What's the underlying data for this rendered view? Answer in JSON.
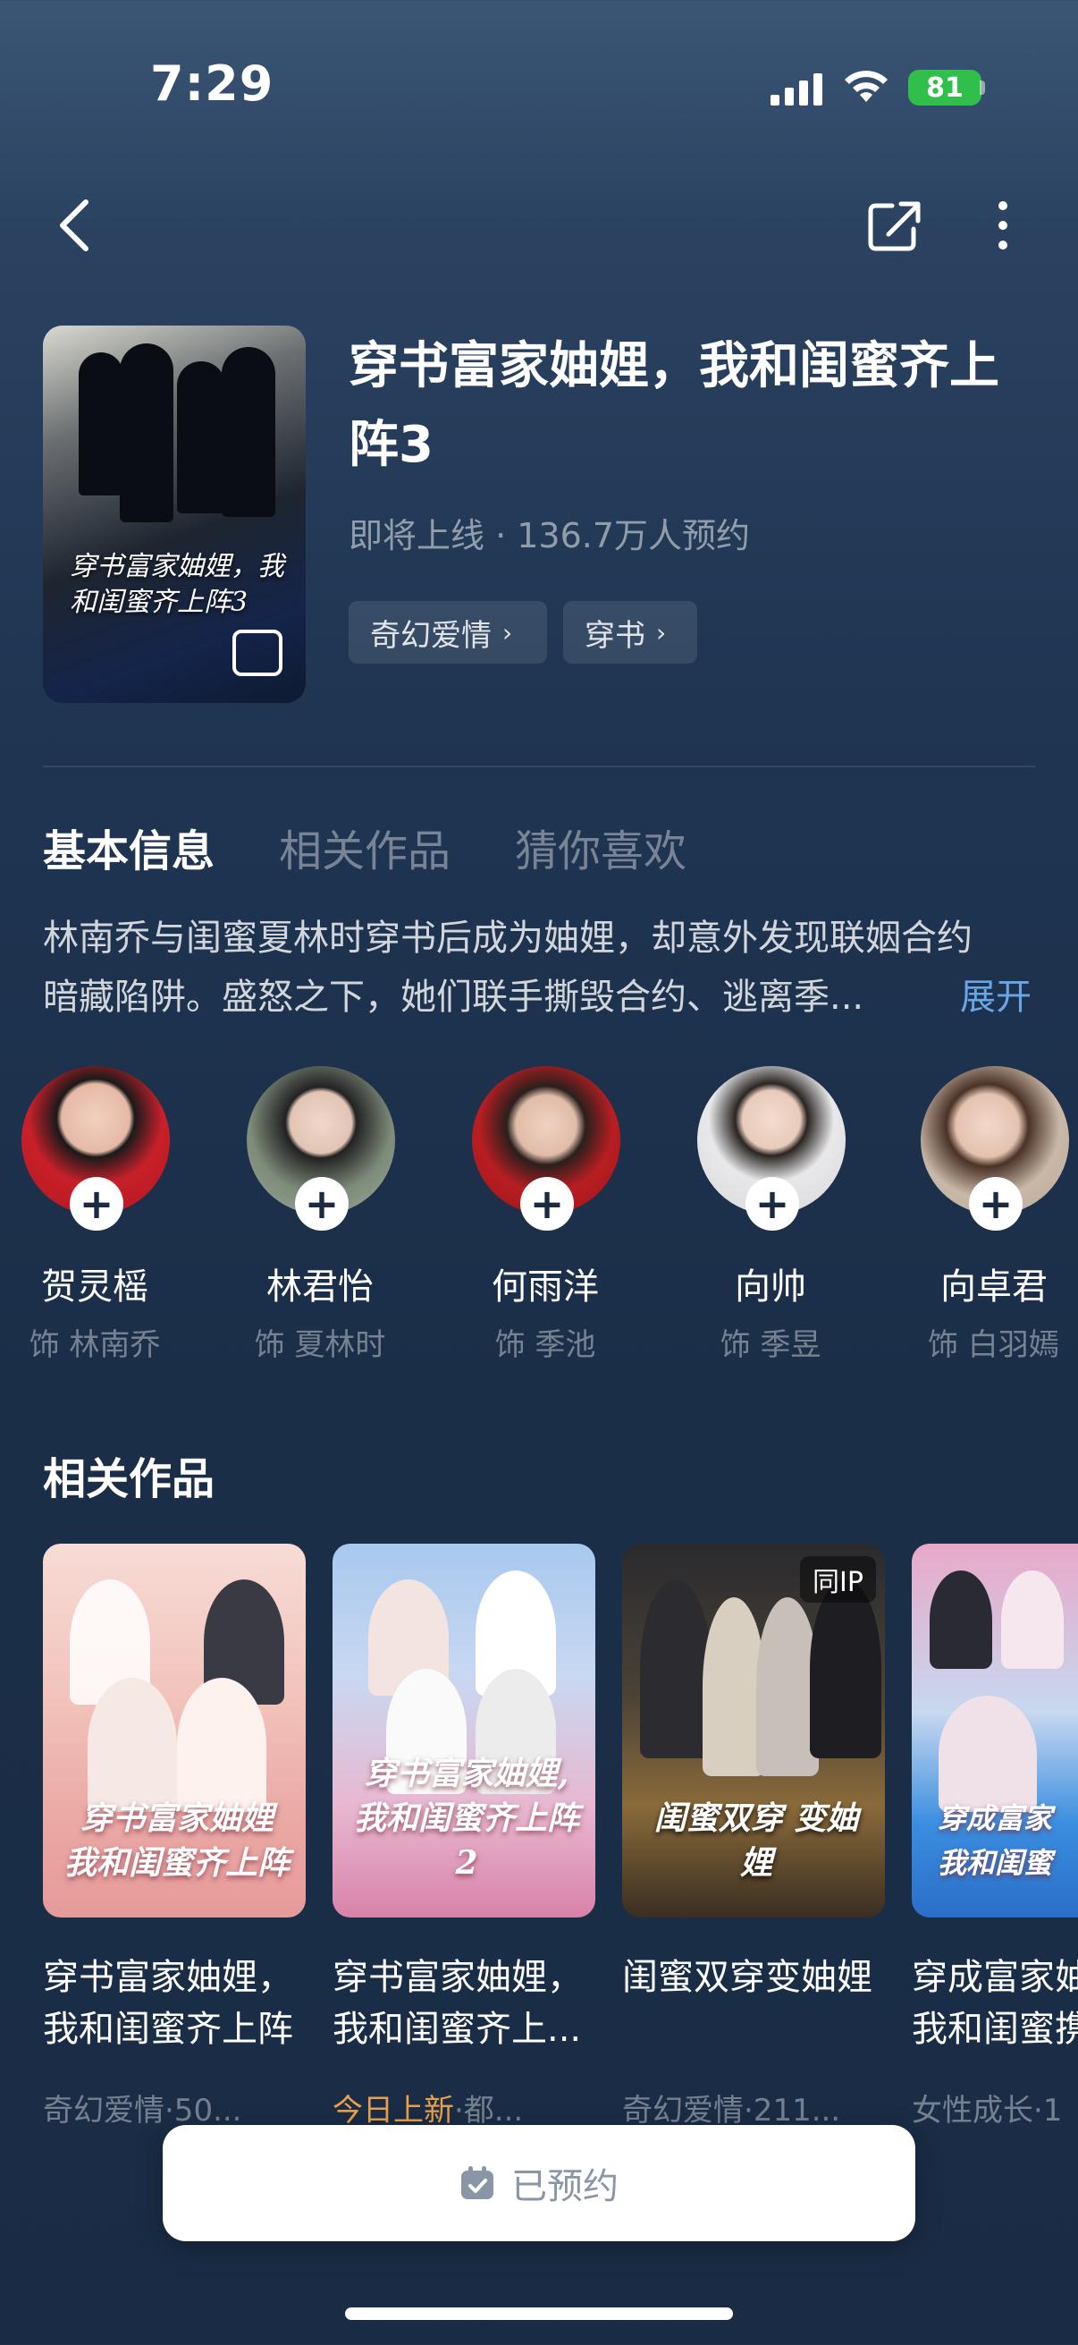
{
  "status": {
    "time": "7:29",
    "battery": "81"
  },
  "drama": {
    "title": "穿书富家妯娌，我和闺蜜齐上阵3",
    "subtitle": "即将上线 · 136.7万人预约",
    "tags": [
      "奇幻爱情",
      "穿书"
    ],
    "poster_title": "穿书富家妯娌，我和闺蜜齐上阵3"
  },
  "tabs": [
    "基本信息",
    "相关作品",
    "猜你喜欢"
  ],
  "synopsis": {
    "line1": "林南乔与闺蜜夏林时穿书后成为妯娌，却意外发现联姻合约",
    "line2": "暗藏陷阱。盛怒之下，她们联手撕毁合约、逃离季...",
    "expand": "展开"
  },
  "cast": [
    {
      "name": "贺灵榣",
      "role": "饰 林南乔",
      "color": "#c8202a"
    },
    {
      "name": "林君怡",
      "role": "饰 夏林时",
      "color": "#8c9a8a"
    },
    {
      "name": "何雨洋",
      "role": "饰 季池",
      "color": "#b81e22"
    },
    {
      "name": "向帅",
      "role": "饰 季昱",
      "color": "#e8e8ea"
    },
    {
      "name": "向卓君",
      "role": "饰 白羽嫣",
      "color": "#c9b8a8"
    }
  ],
  "related": {
    "section_title": "相关作品",
    "items": [
      {
        "poster_title": "穿书富家妯娌 我和闺蜜齐上阵",
        "name_line1": "穿书富家妯娌，",
        "name_line2": "我和闺蜜齐上阵",
        "meta_highlight": "",
        "meta": "奇幻爱情·50...",
        "badge": ""
      },
      {
        "poster_title": "穿书富家妯娌, 我和闺蜜齐上阵2",
        "name_line1": "穿书富家妯娌，",
        "name_line2": "我和闺蜜齐上...",
        "meta_highlight": "今日上新",
        "meta": "·都...",
        "badge": ""
      },
      {
        "poster_title": "闺蜜双穿 变妯娌",
        "name_line1": "闺蜜双穿变妯娌",
        "name_line2": "",
        "meta_highlight": "",
        "meta": "奇幻爱情·211...",
        "badge": "同IP"
      },
      {
        "poster_title": "穿成富家 我和闺蜜",
        "name_line1": "穿成富家妯",
        "name_line2": "我和闺蜜携",
        "meta_highlight": "",
        "meta": "女性成长·1",
        "badge": ""
      }
    ]
  },
  "reserve_button": "已预约",
  "colors": {
    "accent_link": "#6aa6e6",
    "highlight": "#e8a04a",
    "battery": "#2fbf4a"
  }
}
